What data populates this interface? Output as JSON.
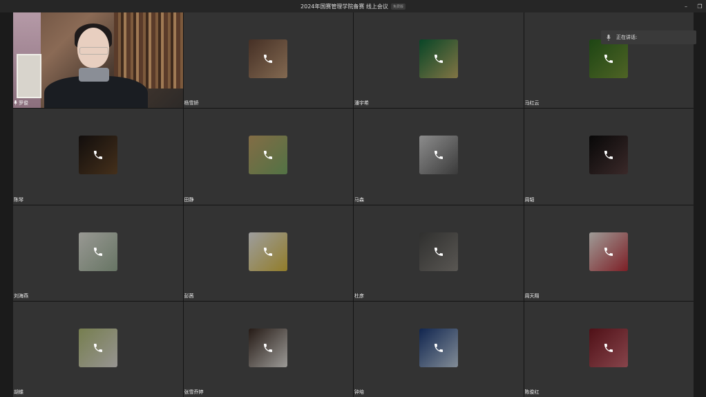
{
  "window": {
    "title": "2024年国赛管理学院备赛 线上会议",
    "badge": "免费版",
    "minimize_glyph": "–",
    "restore_glyph": "❐"
  },
  "speaking_panel": {
    "label": "正在讲话:",
    "icon": "mic-icon"
  },
  "participants": [
    {
      "name": "罗俊",
      "video_on": true,
      "mic": "mic-icon"
    },
    {
      "name": "杨雪娇",
      "avatar_color": "#6b4a3a",
      "avatar_color2": "#c9a27d"
    },
    {
      "name": "潘宇希",
      "avatar_color": "#0d6b3c",
      "avatar_color2": "#c8b46a"
    },
    {
      "name": "马红云",
      "avatar_color": "#2e6b1f",
      "avatar_color2": "#7a9a3a"
    },
    {
      "name": "陈琴",
      "avatar_color": "#1c1614",
      "avatar_color2": "#6a4a2a"
    },
    {
      "name": "田静",
      "avatar_color": "#c9a76a",
      "avatar_color2": "#7fb06a"
    },
    {
      "name": "马森",
      "avatar_color": "#d8d8d8",
      "avatar_color2": "#5a5a5a"
    },
    {
      "name": "周韬",
      "avatar_color": "#0c0c0c",
      "avatar_color2": "#5a4040"
    },
    {
      "name": "刘海燕",
      "avatar_color": "#eaeae2",
      "avatar_color2": "#9fb49a"
    },
    {
      "name": "彭茜",
      "avatar_color": "#f2f2f2",
      "avatar_color2": "#e0c040"
    },
    {
      "name": "杜彦",
      "avatar_color": "#4a4a48",
      "avatar_color2": "#8a8680"
    },
    {
      "name": "周天翔",
      "avatar_color": "#f4efe8",
      "avatar_color2": "#c0303a"
    },
    {
      "name": "胡蝶",
      "avatar_color": "#b6c27a",
      "avatar_color2": "#e8e4e0"
    },
    {
      "name": "张雪乔婷",
      "avatar_color": "#3a2a22",
      "avatar_color2": "#f0ede8"
    },
    {
      "name": "钟培",
      "avatar_color": "#1a3a7a",
      "avatar_color2": "#c8d8e8"
    },
    {
      "name": "陈俊红",
      "avatar_color": "#7a1a24",
      "avatar_color2": "#d06a74"
    }
  ]
}
